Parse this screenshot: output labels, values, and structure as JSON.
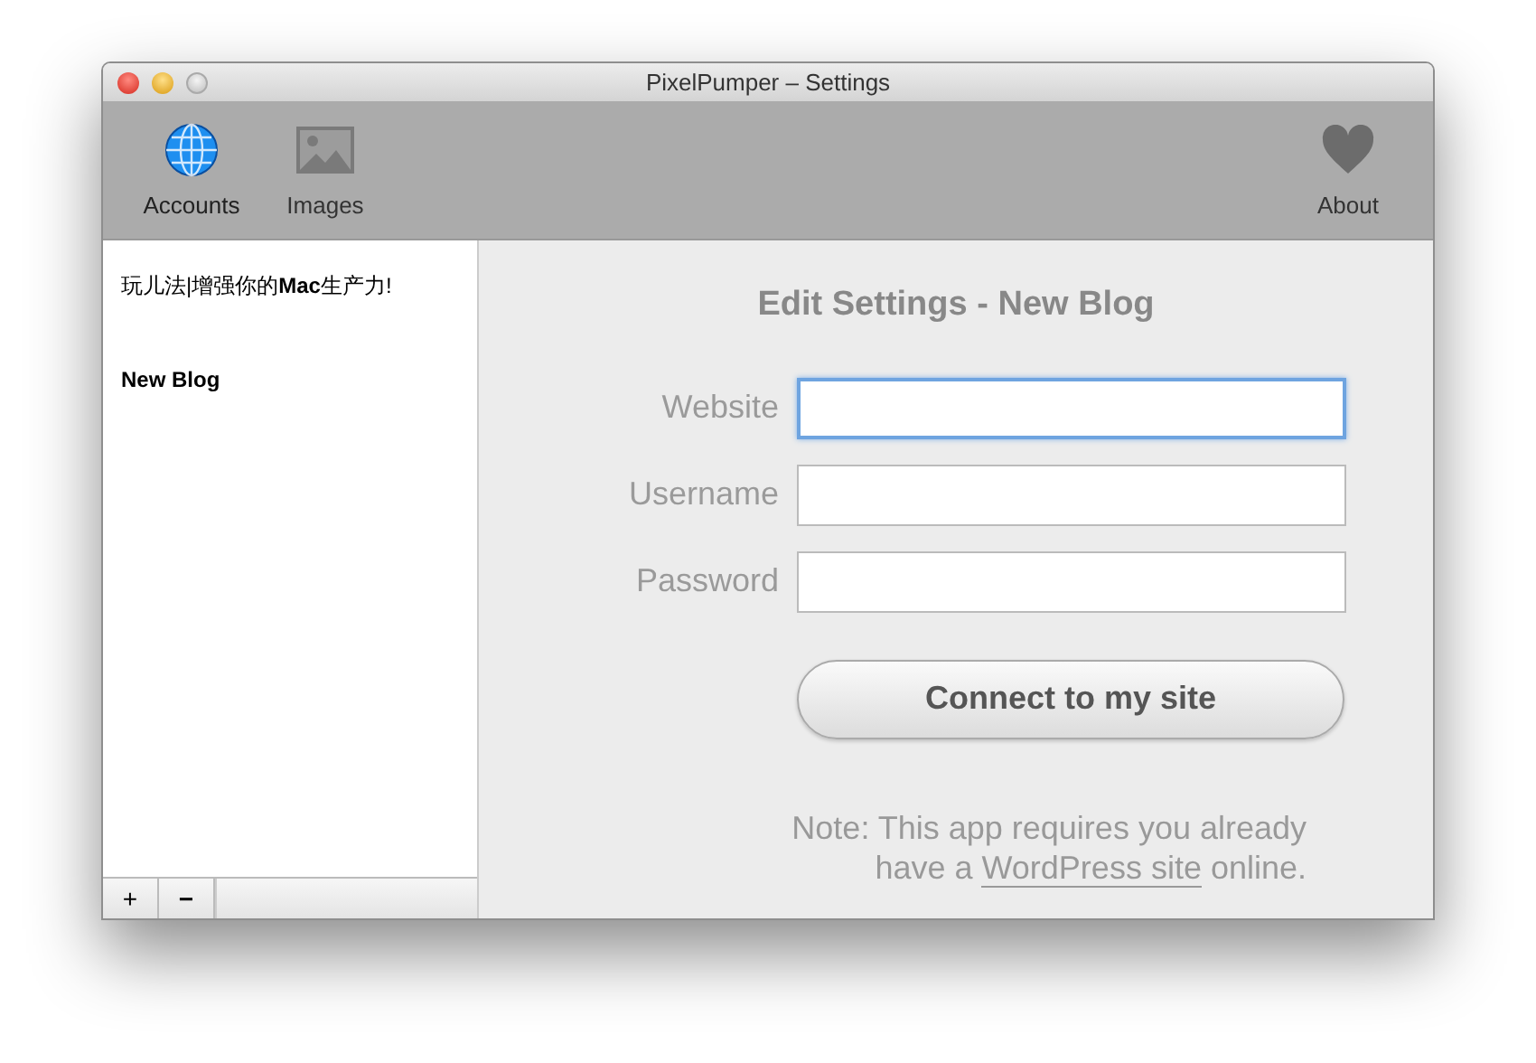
{
  "window": {
    "title": "PixelPumper – Settings"
  },
  "toolbar": [
    {
      "label": "Accounts",
      "kind": "globe",
      "selected": true
    },
    {
      "label": "Images",
      "kind": "image",
      "selected": false
    },
    {
      "label": "About",
      "kind": "heart",
      "selected": false
    }
  ],
  "sidebar": {
    "items": [
      {
        "label": "玩儿法|增强你的**Mac**生产力!",
        "kind": "plain"
      },
      {
        "label": "New Blog",
        "kind": "bold"
      }
    ],
    "buttons": [
      "+",
      "−"
    ]
  },
  "form": {
    "title": "Edit Settings - New Blog",
    "fields": [
      {
        "label": "Website",
        "focused": true
      },
      {
        "label": "Username",
        "focused": false
      },
      {
        "label": "Password",
        "focused": false
      }
    ],
    "button": "Connect to my site",
    "note": {
      "before": "Note: This app requires you already have a ",
      "link": "WordPress site",
      "after": " online."
    }
  }
}
